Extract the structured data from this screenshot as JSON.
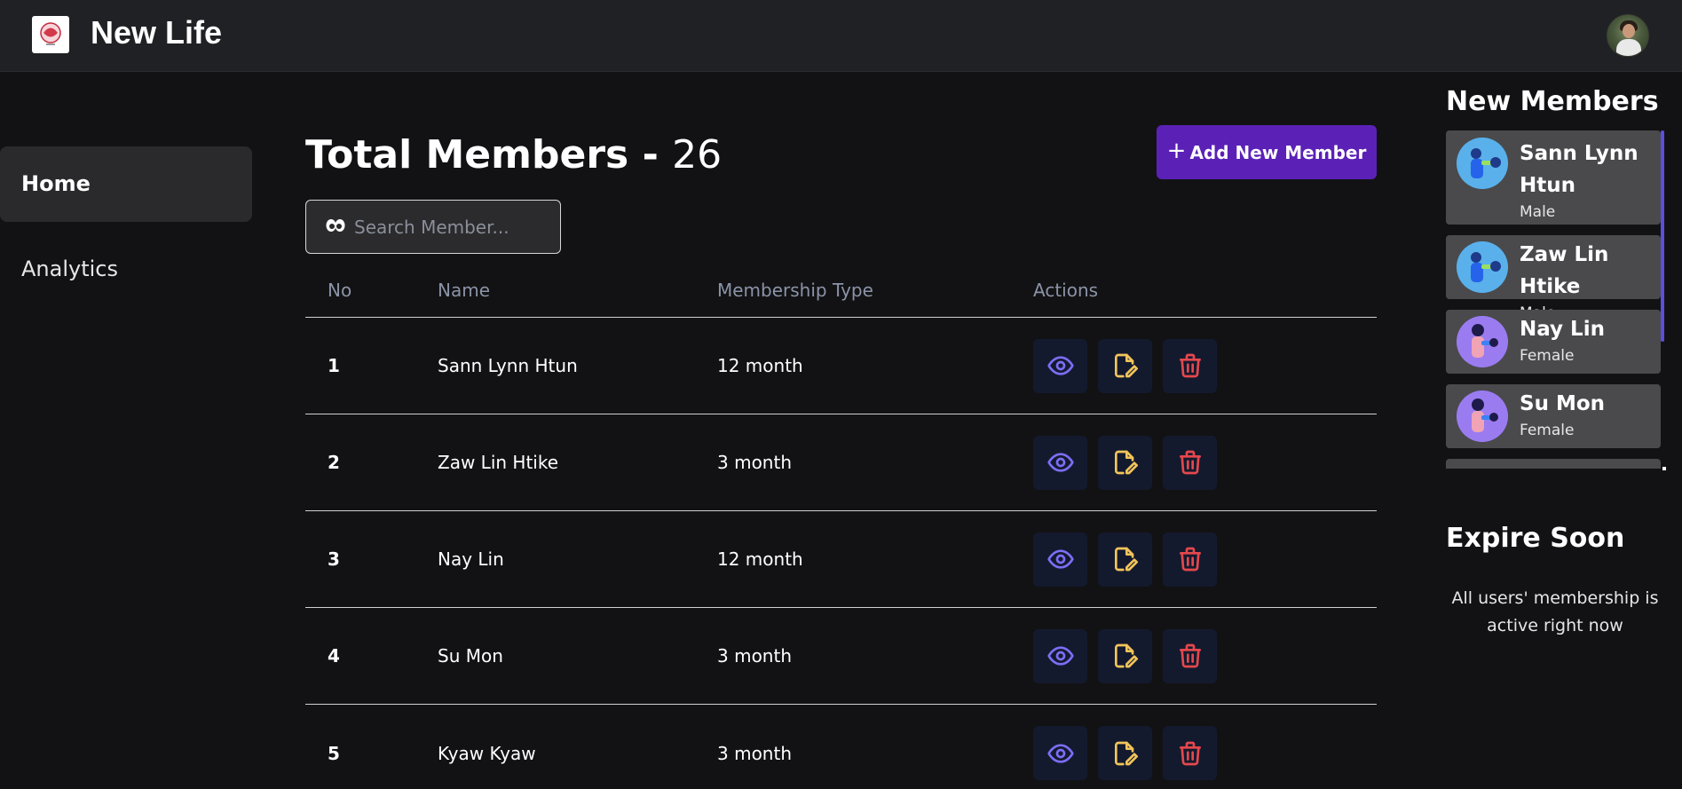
{
  "header": {
    "app_name": "New Life",
    "logo_icon": "gym-logo-icon",
    "avatar_icon": "user-avatar"
  },
  "sidebar": {
    "items": [
      {
        "label": "Home",
        "active": true
      },
      {
        "label": "Analytics",
        "active": false
      }
    ]
  },
  "main": {
    "title_label": "Total Members",
    "title_separator": "-",
    "total_count": "26",
    "add_button_label": "Add New Member",
    "search_placeholder": "Search Member...",
    "columns": [
      "No",
      "Name",
      "Membership Type",
      "Actions"
    ],
    "rows": [
      {
        "no": "1",
        "name": "Sann Lynn Htun",
        "type": "12 month"
      },
      {
        "no": "2",
        "name": "Zaw Lin Htike",
        "type": "3 month"
      },
      {
        "no": "3",
        "name": "Nay Lin",
        "type": "12 month"
      },
      {
        "no": "4",
        "name": "Su Mon",
        "type": "3 month"
      },
      {
        "no": "5",
        "name": "Kyaw Kyaw",
        "type": "3 month"
      }
    ],
    "action_icons": [
      "eye-icon",
      "edit-file-icon",
      "trash-icon"
    ]
  },
  "right_panel": {
    "new_members_title": "New Members",
    "new_members": [
      {
        "name": "Sann Lynn Htun",
        "gender": "Male"
      },
      {
        "name": "Zaw Lin Htike",
        "gender": "Male"
      },
      {
        "name": "Nay Lin",
        "gender": "Female"
      },
      {
        "name": "Su Mon",
        "gender": "Female"
      }
    ],
    "expire_title": "Expire Soon",
    "expire_message": "All users' membership is active right now"
  },
  "colors": {
    "background": "#121214",
    "topbar": "#202124",
    "accent": "#5b21b6",
    "view_icon": "#7c6ef6",
    "edit_icon": "#f2c45a",
    "delete_icon": "#e5484d",
    "card": "#4a4a4c"
  }
}
